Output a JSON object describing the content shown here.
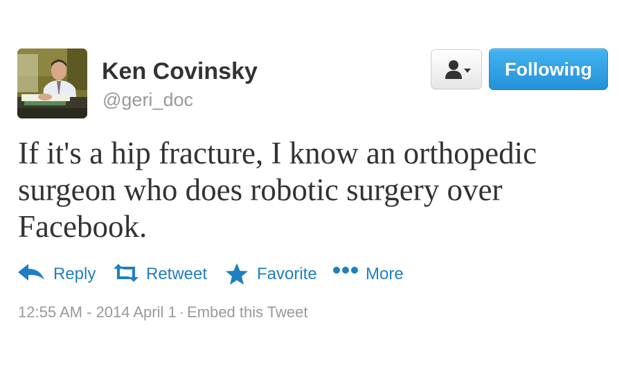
{
  "user": {
    "display_name": "Ken Covinsky",
    "screen_name": "@geri_doc",
    "avatar_icon": "avatar-photo"
  },
  "buttons": {
    "user_menu_icon": "person-dropdown-icon",
    "follow_label": "Following",
    "follow_color": "#2a9ae0"
  },
  "tweet": {
    "text": "If it's a hip fracture, I know an orthopedic surgeon who does robotic surgery over Facebook."
  },
  "actions": [
    {
      "label": "Reply",
      "icon": "reply-icon"
    },
    {
      "label": "Retweet",
      "icon": "retweet-icon"
    },
    {
      "label": "Favorite",
      "icon": "star-icon"
    },
    {
      "label": "More",
      "icon": "more-dots-icon"
    }
  ],
  "meta": {
    "timestamp": "12:55 AM - 2014 April 1",
    "separator": "·",
    "embed_label": "Embed this Tweet"
  },
  "colors": {
    "link": "#1f7fc0",
    "text": "#333333",
    "muted": "#999999"
  }
}
